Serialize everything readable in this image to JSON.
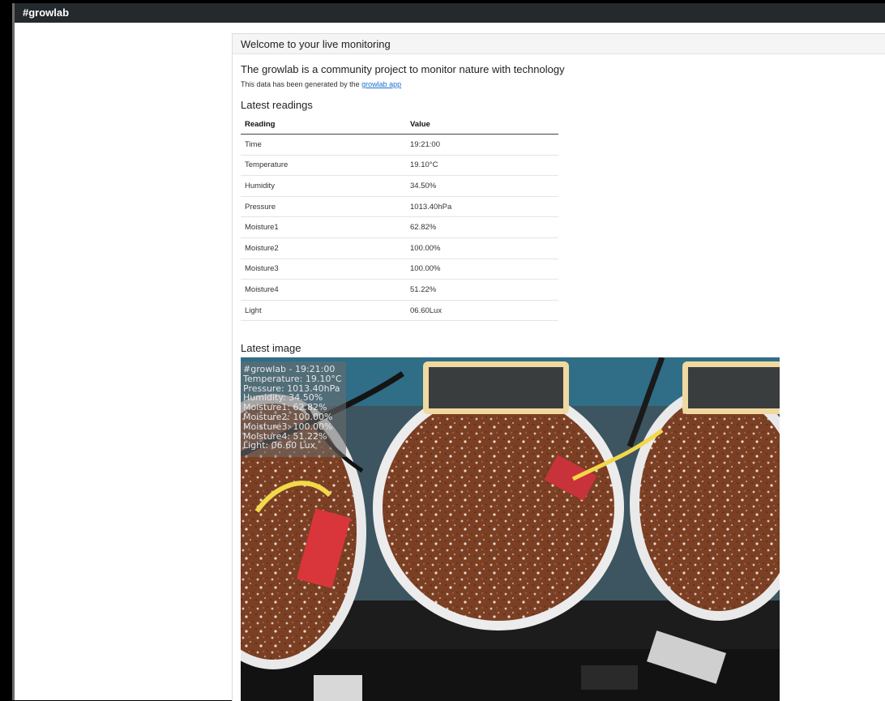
{
  "app": {
    "title": "#growlab"
  },
  "header": {
    "title": "Welcome to your live monitoring"
  },
  "intro": {
    "title": "The growlab is a community project to monitor nature with technology",
    "subtitle_prefix": "This data has been generated by the ",
    "link_text": "growlab app"
  },
  "readings": {
    "title": "Latest readings",
    "columns": [
      "Reading",
      "Value"
    ],
    "rows": [
      [
        "Time",
        "19:21:00"
      ],
      [
        "Temperature",
        "19.10°C"
      ],
      [
        "Humidity",
        "34.50%"
      ],
      [
        "Pressure",
        "1013.40hPa"
      ],
      [
        "Moisture1",
        "62.82%"
      ],
      [
        "Moisture2",
        "100.00%"
      ],
      [
        "Moisture3",
        "100.00%"
      ],
      [
        "Moisture4",
        "51.22%"
      ],
      [
        "Light",
        "06.60Lux"
      ]
    ]
  },
  "image": {
    "title": "Latest image",
    "overlay_lines": [
      "#growlab - 19:21:00",
      "Temperature: 19.10°C",
      "Pressure: 1013.40hPa",
      "Humidity: 34.50%",
      "Moisture1: 62.82%",
      "Moisture2: 100.00%",
      "Moisture3: 100.00%",
      "Moisture4: 51.22%",
      "Light: 06.60 Lux"
    ]
  },
  "colors": {
    "topbar": "#24292e",
    "link": "#1a6fd0",
    "soil": "#7a3d22",
    "pot": "#e8e8e8"
  }
}
